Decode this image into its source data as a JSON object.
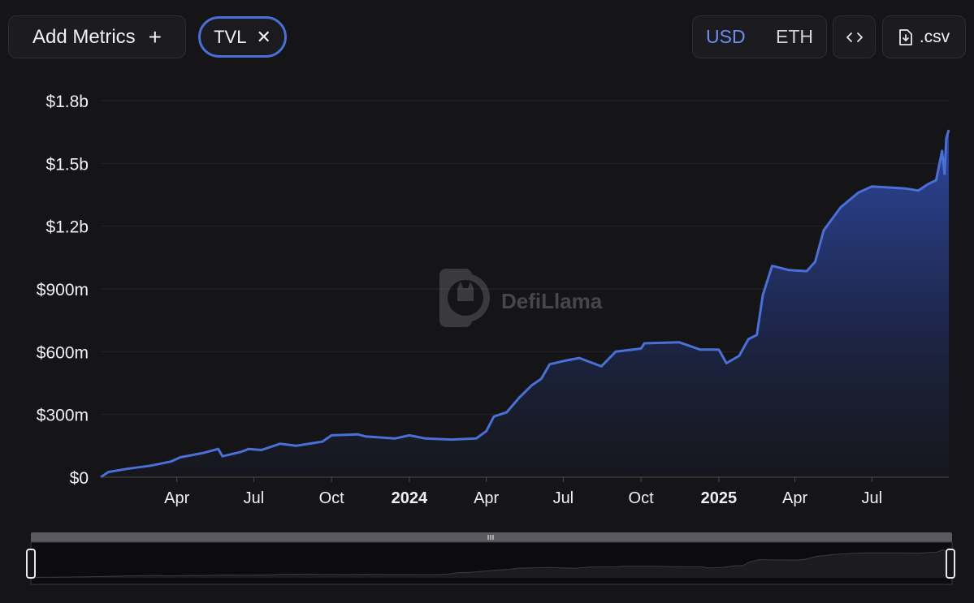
{
  "toolbar": {
    "add_metrics_label": "Add Metrics",
    "add_icon": "plus-icon",
    "metric_chip_label": "TVL",
    "remove_icon": "close-icon",
    "currency_options": [
      "USD",
      "ETH"
    ],
    "currency_selected": "USD",
    "embed_icon": "code-icon",
    "csv_label": ".csv",
    "csv_icon": "download-file-icon"
  },
  "watermark": "DefiLlama",
  "colors": {
    "background": "#151518",
    "line": "#4a6fd6",
    "accent": "#6d8ef0"
  },
  "chart_data": {
    "type": "area",
    "title": "",
    "xlabel": "",
    "ylabel": "",
    "ylim": [
      0,
      1800000000
    ],
    "yticks": [
      "$0",
      "$300m",
      "$600m",
      "$900m",
      "$1.2b",
      "$1.5b",
      "$1.8b"
    ],
    "xticks": [
      {
        "label": "Apr",
        "date": "2023-04-01",
        "bold": false
      },
      {
        "label": "Jul",
        "date": "2023-07-01",
        "bold": false
      },
      {
        "label": "Oct",
        "date": "2023-10-01",
        "bold": false
      },
      {
        "label": "2024",
        "date": "2024-01-01",
        "bold": true
      },
      {
        "label": "Apr",
        "date": "2024-04-01",
        "bold": false
      },
      {
        "label": "Jul",
        "date": "2024-07-01",
        "bold": false
      },
      {
        "label": "Oct",
        "date": "2024-10-01",
        "bold": false
      },
      {
        "label": "2025",
        "date": "2025-01-01",
        "bold": true
      },
      {
        "label": "Apr",
        "date": "2025-04-01",
        "bold": false
      },
      {
        "label": "Jul",
        "date": "2025-07-01",
        "bold": false
      }
    ],
    "grid": "horizontal",
    "series": [
      {
        "points": [
          [
            "2023-01-01",
            0
          ],
          [
            "2023-01-10",
            25000000
          ],
          [
            "2023-02-01",
            40000000
          ],
          [
            "2023-03-01",
            55000000
          ],
          [
            "2023-03-25",
            75000000
          ],
          [
            "2023-04-05",
            95000000
          ],
          [
            "2023-05-01",
            115000000
          ],
          [
            "2023-05-20",
            135000000
          ],
          [
            "2023-05-25",
            100000000
          ],
          [
            "2023-06-15",
            120000000
          ],
          [
            "2023-06-25",
            135000000
          ],
          [
            "2023-07-10",
            130000000
          ],
          [
            "2023-08-01",
            160000000
          ],
          [
            "2023-08-20",
            150000000
          ],
          [
            "2023-09-20",
            170000000
          ],
          [
            "2023-10-01",
            200000000
          ],
          [
            "2023-11-01",
            205000000
          ],
          [
            "2023-11-10",
            195000000
          ],
          [
            "2023-12-15",
            185000000
          ],
          [
            "2024-01-01",
            200000000
          ],
          [
            "2024-01-20",
            185000000
          ],
          [
            "2024-02-20",
            180000000
          ],
          [
            "2024-03-20",
            185000000
          ],
          [
            "2024-04-01",
            220000000
          ],
          [
            "2024-04-10",
            290000000
          ],
          [
            "2024-04-25",
            310000000
          ],
          [
            "2024-05-10",
            380000000
          ],
          [
            "2024-05-25",
            440000000
          ],
          [
            "2024-06-05",
            470000000
          ],
          [
            "2024-06-15",
            540000000
          ],
          [
            "2024-07-01",
            555000000
          ],
          [
            "2024-07-20",
            570000000
          ],
          [
            "2024-08-15",
            530000000
          ],
          [
            "2024-09-01",
            600000000
          ],
          [
            "2024-10-01",
            615000000
          ],
          [
            "2024-10-05",
            640000000
          ],
          [
            "2024-11-15",
            645000000
          ],
          [
            "2024-12-10",
            610000000
          ],
          [
            "2025-01-01",
            610000000
          ],
          [
            "2025-01-10",
            545000000
          ],
          [
            "2025-01-25",
            580000000
          ],
          [
            "2025-02-05",
            660000000
          ],
          [
            "2025-02-15",
            680000000
          ],
          [
            "2025-02-22",
            870000000
          ],
          [
            "2025-03-05",
            1010000000
          ],
          [
            "2025-03-25",
            990000000
          ],
          [
            "2025-04-15",
            985000000
          ],
          [
            "2025-04-25",
            1030000000
          ],
          [
            "2025-05-05",
            1180000000
          ],
          [
            "2025-05-25",
            1290000000
          ],
          [
            "2025-06-15",
            1360000000
          ],
          [
            "2025-07-01",
            1390000000
          ],
          [
            "2025-08-10",
            1380000000
          ],
          [
            "2025-08-25",
            1370000000
          ],
          [
            "2025-09-05",
            1400000000
          ],
          [
            "2025-09-15",
            1420000000
          ],
          [
            "2025-09-22",
            1560000000
          ],
          [
            "2025-09-25",
            1450000000
          ],
          [
            "2025-09-27",
            1620000000
          ],
          [
            "2025-09-30",
            1660000000
          ]
        ]
      }
    ]
  }
}
